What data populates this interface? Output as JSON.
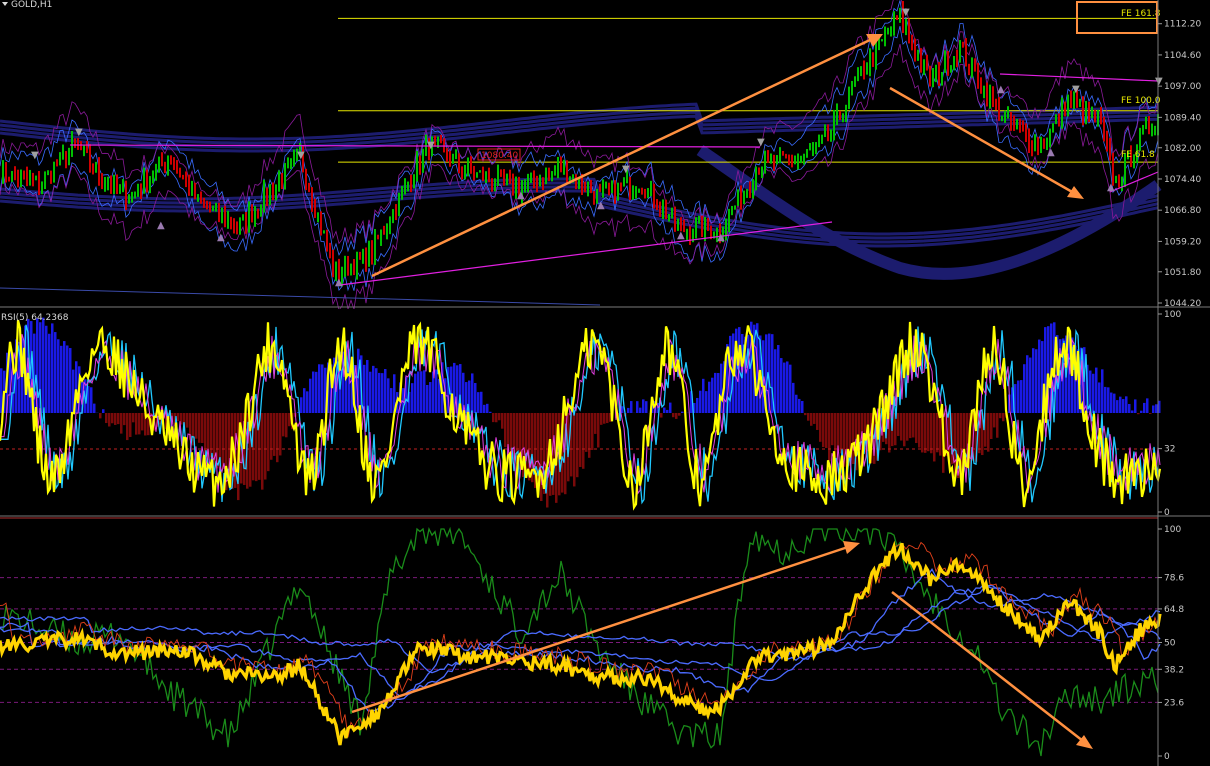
{
  "chart_data": [
    {
      "type": "line",
      "title": "GOLD,H1",
      "symbol": "GOLD",
      "timeframe": "H1",
      "ylim": [
        1044.2,
        1117.0
      ],
      "y_ticks": [
        "1112.20",
        "1104.60",
        "1097.00",
        "1089.40",
        "1082.00",
        "1074.40",
        "1066.80",
        "1059.20",
        "1051.80",
        "1044.20"
      ],
      "y_tick_values": [
        1112.2,
        1104.6,
        1097.0,
        1089.4,
        1082.0,
        1074.4,
        1066.8,
        1059.2,
        1051.8,
        1044.2
      ],
      "fib_levels": [
        {
          "label": "FE 161.8",
          "value": 1113.5
        },
        {
          "label": "FE 100.0",
          "value": 1091.0
        },
        {
          "label": "FE 61.8",
          "value": 1078.5
        }
      ],
      "price_tag": {
        "label": "1080.40",
        "value": 1080.4
      },
      "path_keypoints": [
        [
          0,
          1076
        ],
        [
          40,
          1073
        ],
        [
          75,
          1083
        ],
        [
          100,
          1075
        ],
        [
          130,
          1070
        ],
        [
          170,
          1080
        ],
        [
          200,
          1068
        ],
        [
          240,
          1063
        ],
        [
          300,
          1080
        ],
        [
          335,
          1051
        ],
        [
          370,
          1056
        ],
        [
          400,
          1070
        ],
        [
          430,
          1083
        ],
        [
          470,
          1076
        ],
        [
          520,
          1072
        ],
        [
          560,
          1077
        ],
        [
          600,
          1070
        ],
        [
          640,
          1074
        ],
        [
          680,
          1062
        ],
        [
          720,
          1062
        ],
        [
          760,
          1078
        ],
        [
          800,
          1079
        ],
        [
          830,
          1085
        ],
        [
          860,
          1100
        ],
        [
          900,
          1114
        ],
        [
          930,
          1098
        ],
        [
          960,
          1106
        ],
        [
          1000,
          1090
        ],
        [
          1040,
          1082
        ],
        [
          1070,
          1094
        ],
        [
          1100,
          1088
        ],
        [
          1115,
          1073
        ],
        [
          1140,
          1084
        ],
        [
          1160,
          1090
        ]
      ],
      "colors": {
        "up": "#00c000",
        "down": "#d00000",
        "fib": "#e6e600",
        "trend": "#ff9040",
        "magenta": "#e020e0",
        "band": "#1c1c6e"
      }
    },
    {
      "type": "line",
      "title": "RSI(5) 64.2368",
      "indicator": "RSI(5)",
      "last_value": 64.2368,
      "ylim": [
        0,
        100
      ],
      "y_ticks": [
        "100",
        "32",
        "0"
      ],
      "y_tick_values": [
        100,
        32,
        0
      ],
      "level": 32
    },
    {
      "type": "line",
      "ylim": [
        0,
        100
      ],
      "y_ticks": [
        "100",
        "78.6",
        "64.8",
        "50",
        "38.2",
        "23.6",
        "0"
      ],
      "y_tick_values": [
        100,
        78.6,
        64.8,
        50,
        38.2,
        23.6,
        0
      ],
      "yellow_keypoints": [
        [
          0,
          48
        ],
        [
          80,
          52
        ],
        [
          120,
          45
        ],
        [
          180,
          47
        ],
        [
          230,
          36
        ],
        [
          280,
          35
        ],
        [
          300,
          40
        ],
        [
          340,
          8
        ],
        [
          380,
          20
        ],
        [
          420,
          48
        ],
        [
          470,
          44
        ],
        [
          520,
          42
        ],
        [
          560,
          40
        ],
        [
          600,
          35
        ],
        [
          650,
          34
        ],
        [
          700,
          20
        ],
        [
          720,
          22
        ],
        [
          760,
          45
        ],
        [
          800,
          45
        ],
        [
          830,
          50
        ],
        [
          860,
          72
        ],
        [
          900,
          92
        ],
        [
          930,
          78
        ],
        [
          960,
          84
        ],
        [
          1000,
          68
        ],
        [
          1040,
          52
        ],
        [
          1070,
          68
        ],
        [
          1100,
          54
        ],
        [
          1115,
          40
        ],
        [
          1140,
          55
        ],
        [
          1160,
          60
        ]
      ],
      "green_keypoints": [
        [
          0,
          63
        ],
        [
          80,
          50
        ],
        [
          120,
          54
        ],
        [
          170,
          28
        ],
        [
          230,
          8
        ],
        [
          300,
          78
        ],
        [
          330,
          45
        ],
        [
          360,
          16
        ],
        [
          390,
          78
        ],
        [
          420,
          100
        ],
        [
          460,
          98
        ],
        [
          520,
          55
        ],
        [
          560,
          80
        ],
        [
          600,
          46
        ],
        [
          640,
          25
        ],
        [
          680,
          10
        ],
        [
          720,
          8
        ],
        [
          750,
          100
        ],
        [
          780,
          90
        ],
        [
          820,
          100
        ],
        [
          880,
          100
        ],
        [
          930,
          70
        ],
        [
          980,
          44
        ],
        [
          1000,
          22
        ],
        [
          1040,
          4
        ],
        [
          1070,
          28
        ],
        [
          1100,
          25
        ],
        [
          1130,
          30
        ],
        [
          1160,
          34
        ]
      ],
      "colors": {
        "yellow": "#ffd400",
        "green": "#1a8c1a",
        "blue": "#4b6bff",
        "red": "#e0401a",
        "arrow": "#ff9040"
      }
    }
  ]
}
